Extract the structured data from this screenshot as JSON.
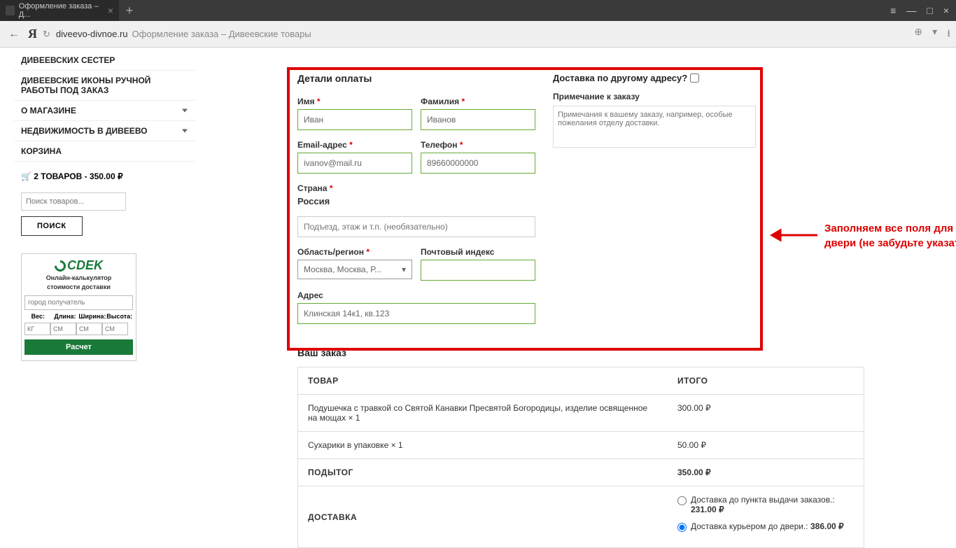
{
  "browser": {
    "tab_title": "Оформление заказа – Д...",
    "url_domain": "diveevo-divnoe.ru",
    "url_title": "Оформление заказа – Дивеевские товары"
  },
  "sidebar": {
    "items": [
      {
        "label": "ДИВЕЕВСКИХ СЕСТЕР"
      },
      {
        "label": "ДИВЕЕВСКИЕ ИКОНЫ РУЧНОЙ РАБОТЫ ПОД ЗАКАЗ"
      },
      {
        "label": "О МАГАЗИНЕ"
      },
      {
        "label": "НЕДВИЖИМОСТЬ В ДИВЕЕВО"
      },
      {
        "label": "КОРЗИНА"
      }
    ],
    "cart_summary": "2 ТОВАРОВ - 350.00 ₽",
    "search_placeholder": "Поиск товаров...",
    "search_btn": "ПОИСК"
  },
  "cdek": {
    "brand": "CDEK",
    "sub1": "Онлайн-калькулятор",
    "sub2": "стоимости доставки",
    "city_placeholder": "город получатель",
    "labels": {
      "weight": "Вес:",
      "length": "Длина:",
      "width": "Ширина:",
      "height": "Высота:"
    },
    "units": {
      "weight": "КГ",
      "dim": "СМ"
    },
    "calc_btn": "Расчет"
  },
  "checkout": {
    "billing_title": "Детали оплаты",
    "shipping_title": "Доставка по другому адресу?",
    "note_label": "Примечание к заказу",
    "note_placeholder": "Примечания к вашему заказу, например, особые пожелания отделу доставки.",
    "fields": {
      "fname_label": "Имя",
      "fname_val": "Иван",
      "lname_label": "Фамилия",
      "lname_val": "Иванов",
      "email_label": "Email-адрес",
      "email_val": "ivanov@mail.ru",
      "phone_label": "Телефон",
      "phone_val": "89660000000",
      "country_label": "Страна",
      "country_val": "Россия",
      "addr2_placeholder": "Подъезд, этаж и т.п. (необязательно)",
      "region_label": "Область/регион",
      "region_val": "Москва, Москва, Р...",
      "postcode_label": "Почтовый индекс",
      "addr_label": "Адрес",
      "addr_val": "Клинская 14к1, кв.123"
    }
  },
  "order": {
    "title": "Ваш заказ",
    "head_product": "ТОВАР",
    "head_total": "ИТОГО",
    "items": [
      {
        "name": "Подушечка с травкой со Святой Канавки Пресвятой Богородицы, изделие освященное на мощах  × 1",
        "total": "300.00 ₽"
      },
      {
        "name": "Сухарики в упаковке  × 1",
        "total": "50.00 ₽"
      }
    ],
    "subtotal_label": "ПОДЫТОГ",
    "subtotal": "350.00 ₽",
    "delivery_label": "ДОСТАВКА",
    "delivery_opts": [
      {
        "label": "Доставка до пункта выдачи заказов.:",
        "price": "231.00 ₽",
        "checked": false
      },
      {
        "label": "Доставка курьером до двери.:",
        "price": "386.00 ₽",
        "checked": true
      }
    ]
  },
  "annotation": "Заполняем все поля для доставки курьером до двери (не забудьте указать точный адрес)."
}
